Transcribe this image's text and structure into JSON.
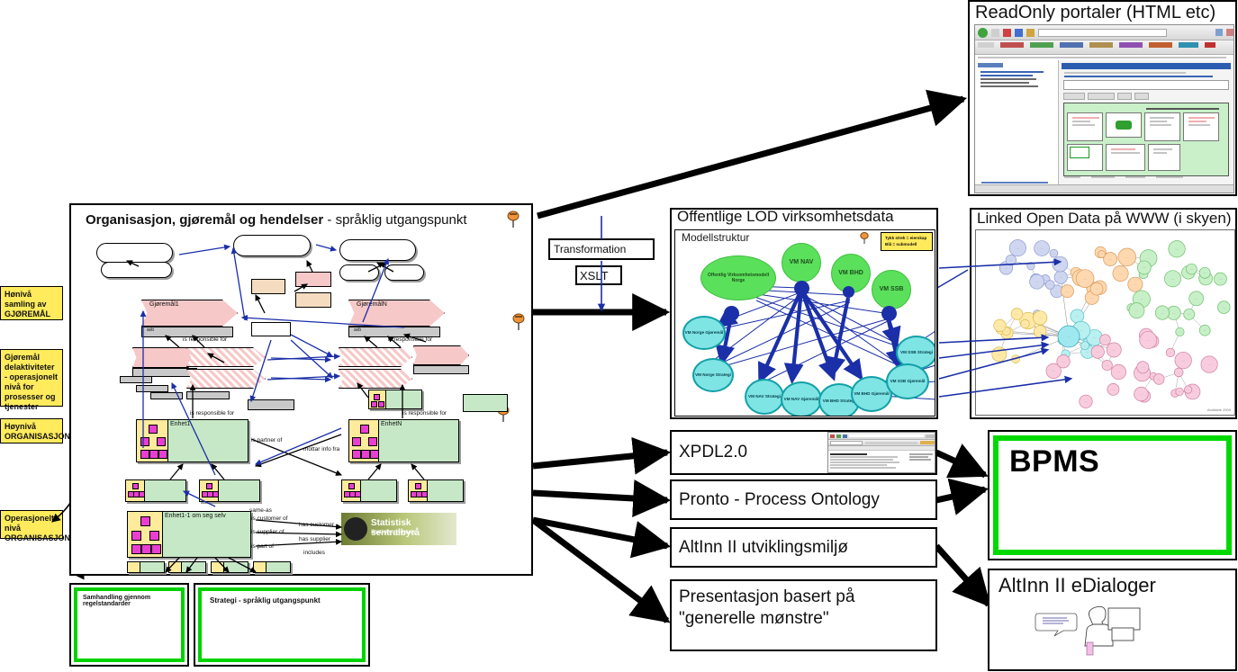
{
  "main_canvas": {
    "title_bold": "Organisasjon, gjøremål og hendelser",
    "title_rest": " - språklig utgangspunkt",
    "goal_nodes": [
      {
        "name": "Gjøremål1",
        "sub": "avb"
      },
      {
        "name": "GjøremålN",
        "sub": "avb"
      }
    ],
    "relations": [
      "is responsible for",
      "is responsible for",
      "is responsible for",
      "is responsible for",
      "is partner of",
      "mottar info fra",
      "same-as",
      "is customer of",
      "has customer",
      "is supplier of",
      "has supplier",
      "is part of",
      "includes"
    ],
    "entities": [
      {
        "name": "Enhet1"
      },
      {
        "name": "EnhetN"
      },
      {
        "name": "Enhet1-1 om seg selv"
      }
    ],
    "logo": {
      "line1": "Statistisk sentralbyrå",
      "line2": "Statistics Norway"
    }
  },
  "stickies": [
    {
      "text": "Hønivå samling av GJØREMÅL"
    },
    {
      "text": "Gjøremål delaktiviteter - operasjonelt nivå for prosesser og tjenester"
    },
    {
      "text": "Høynivå ORGANISASJON"
    },
    {
      "text": "Operasjonelt nivå ORGANISASJON"
    }
  ],
  "transformation": {
    "label": "Transformation",
    "sub_label": "XSLT"
  },
  "panels": {
    "readonly_portal": {
      "title": "ReadOnly portaler (HTML etc)"
    },
    "lod_virksomhet": {
      "title": "Offentlige LOD virksomhetsdata",
      "subtitle": "Modellstruktur",
      "legend": "Tykk strek = eierskap\nBlå = submodell",
      "green_nodes": [
        "Offentlig Virksomhetsmodell Norge",
        "VM NAV",
        "VM BHD",
        "VM SSB"
      ],
      "cyan_nodes": [
        "VM Norge Gjøremål",
        "VM Norge Strategi",
        "VM NAV Strategi",
        "VM NAV Gjøremål",
        "VM BHD Strategi",
        "VM BHD Gjøremål",
        "VM SSB Strategi",
        "VM SSB Gjøremål"
      ]
    },
    "lod_www": {
      "title": "Linked Open Data på WWW (i skyen)",
      "credit": "Available 2009"
    }
  },
  "flow_boxes": [
    {
      "label": "XPDL2.0",
      "has_thumbnail": true
    },
    {
      "label": "Pronto - Process Ontology",
      "has_thumbnail": false
    },
    {
      "label": "AltInn II utviklingsmiljø",
      "has_thumbnail": false
    },
    {
      "label": "Presentasjon basert på\n\"generelle mønstre\"",
      "has_thumbnail": false
    }
  ],
  "flow_box_lines": {
    "presentasjon_l1": "Presentasjon basert på",
    "presentasjon_l2": "\"generelle mønstre\""
  },
  "bpms": {
    "title": "BPMS"
  },
  "altinn": {
    "title": "AltInn II eDialoger"
  },
  "bottom_boxes": [
    {
      "caption": "Samhandling gjennom regelstandarder"
    },
    {
      "caption": "Strategi - språklig utgangspunkt"
    }
  ],
  "colors": {
    "accent_green": "#00d200",
    "goal_pink": "#f6c8c8",
    "entity_green": "#c6e8c6",
    "sticky_yellow": "#ffeb5c",
    "arrow_blue": "#1b2fa8",
    "node_green": "#5be05b",
    "node_cyan": "#7fe4e4"
  }
}
